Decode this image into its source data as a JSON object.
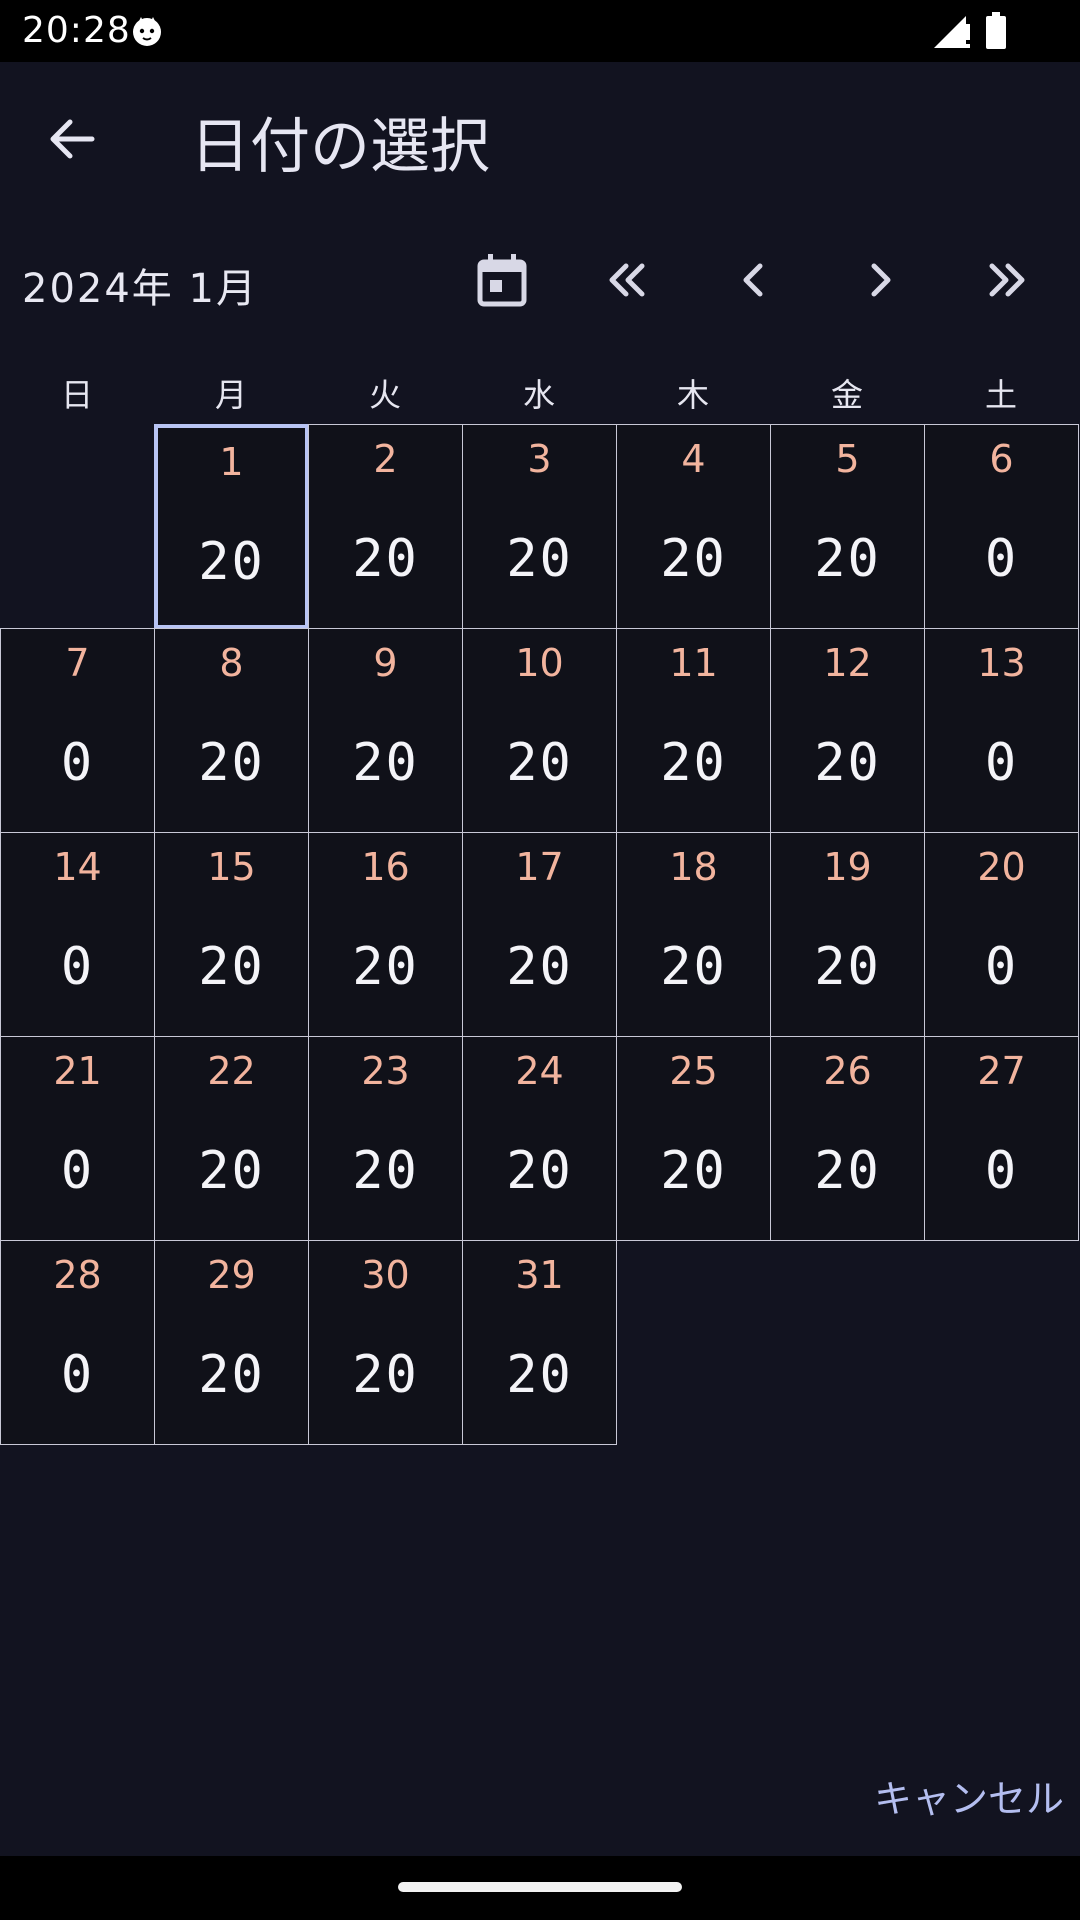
{
  "status_bar": {
    "time": "20:28"
  },
  "header": {
    "title": "日付の選択"
  },
  "calendar": {
    "month_label": "2024年 1月",
    "weekdays": [
      "日",
      "月",
      "火",
      "水",
      "木",
      "金",
      "土"
    ],
    "first_weekday_index": 1,
    "selected_day": 1,
    "days": [
      {
        "day": "1",
        "value": "20"
      },
      {
        "day": "2",
        "value": "20"
      },
      {
        "day": "3",
        "value": "20"
      },
      {
        "day": "4",
        "value": "20"
      },
      {
        "day": "5",
        "value": "20"
      },
      {
        "day": "6",
        "value": "0"
      },
      {
        "day": "7",
        "value": "0"
      },
      {
        "day": "8",
        "value": "20"
      },
      {
        "day": "9",
        "value": "20"
      },
      {
        "day": "10",
        "value": "20"
      },
      {
        "day": "11",
        "value": "20"
      },
      {
        "day": "12",
        "value": "20"
      },
      {
        "day": "13",
        "value": "0"
      },
      {
        "day": "14",
        "value": "0"
      },
      {
        "day": "15",
        "value": "20"
      },
      {
        "day": "16",
        "value": "20"
      },
      {
        "day": "17",
        "value": "20"
      },
      {
        "day": "18",
        "value": "20"
      },
      {
        "day": "19",
        "value": "20"
      },
      {
        "day": "20",
        "value": "0"
      },
      {
        "day": "21",
        "value": "0"
      },
      {
        "day": "22",
        "value": "20"
      },
      {
        "day": "23",
        "value": "20"
      },
      {
        "day": "24",
        "value": "20"
      },
      {
        "day": "25",
        "value": "20"
      },
      {
        "day": "26",
        "value": "20"
      },
      {
        "day": "27",
        "value": "0"
      },
      {
        "day": "28",
        "value": "0"
      },
      {
        "day": "29",
        "value": "20"
      },
      {
        "day": "30",
        "value": "20"
      },
      {
        "day": "31",
        "value": "20"
      }
    ]
  },
  "footer": {
    "cancel_label": "キャンセル"
  },
  "colors": {
    "background": "#121320",
    "day_number": "#f2b49e",
    "accent": "#b4bef0",
    "selected_border": "#b8c4f4"
  },
  "icons": {
    "status": [
      "cat-icon",
      "signal-icon",
      "battery-icon"
    ],
    "navigation": [
      "back-arrow-icon",
      "calendar-icon",
      "double-chevron-left-icon",
      "chevron-left-icon",
      "chevron-right-icon",
      "double-chevron-right-icon"
    ]
  }
}
